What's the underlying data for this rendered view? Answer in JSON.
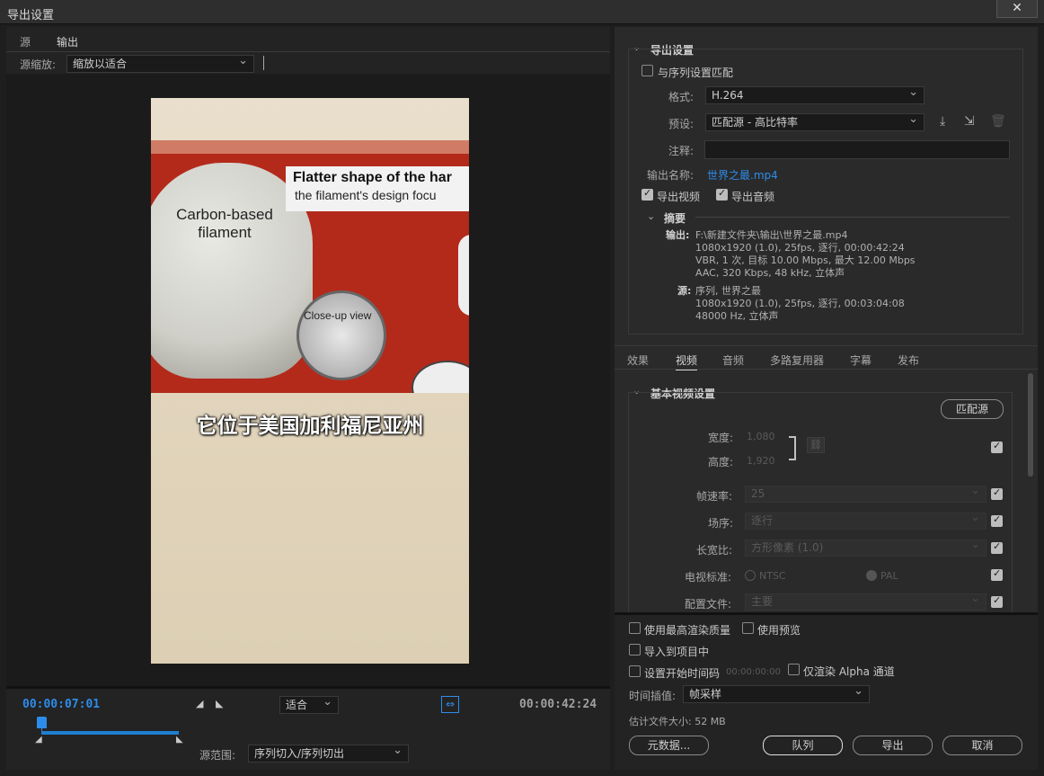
{
  "window": {
    "title": "导出设置",
    "close": "✕"
  },
  "left": {
    "tabs": [
      "源",
      "输出"
    ],
    "source_scaling_label": "源缩放:",
    "source_scaling_value": "缩放以适合",
    "preview": {
      "callout_line1": "Flatter shape of the har",
      "callout_line2": "the filament's design focu",
      "bulb_label": "Carbon-based filament",
      "closeup_label": "Close-up view",
      "subtitle": "它位于美国加利福尼亚州"
    },
    "timeline": {
      "current_time": "00:00:07:01",
      "end_time": "00:00:42:24",
      "fit_value": "适合",
      "source_range_label": "源范围:",
      "source_range_value": "序列切入/序列切出"
    }
  },
  "export": {
    "section_title": "导出设置",
    "match_sequence_label": "与序列设置匹配",
    "format_label": "格式:",
    "format_value": "H.264",
    "preset_label": "预设:",
    "preset_value": "匹配源 - 高比特率",
    "comment_label": "注释:",
    "comment_value": "",
    "output_name_label": "输出名称:",
    "output_name_value": "世界之最.mp4",
    "export_video_label": "导出视频",
    "export_audio_label": "导出音频",
    "summary_title": "摘要",
    "summary_output_label": "输出:",
    "summary_output_lines": [
      "F:\\新建文件夹\\输出\\世界之最.mp4",
      "1080x1920 (1.0), 25fps, 逐行, 00:00:42:24",
      "VBR, 1 次, 目标 10.00 Mbps, 最大 12.00 Mbps",
      "AAC, 320 Kbps, 48 kHz, 立体声"
    ],
    "summary_source_label": "源:",
    "summary_source_lines": [
      "序列, 世界之最",
      "1080x1920 (1.0), 25fps, 逐行, 00:03:04:08",
      "48000 Hz, 立体声"
    ]
  },
  "settings_tabs": [
    "效果",
    "视频",
    "音频",
    "多路复用器",
    "字幕",
    "发布"
  ],
  "video": {
    "section_title": "基本视频设置",
    "match_source_button": "匹配源",
    "width_label": "宽度:",
    "width_value": "1,080",
    "height_label": "高度:",
    "height_value": "1,920",
    "framerate_label": "帧速率:",
    "framerate_value": "25",
    "field_order_label": "场序:",
    "field_order_value": "逐行",
    "aspect_label": "长宽比:",
    "aspect_value": "方形像素 (1.0)",
    "tv_standard_label": "电视标准:",
    "ntsc": "NTSC",
    "pal": "PAL",
    "profile_label": "配置文件:",
    "profile_value": "主要"
  },
  "bottom": {
    "max_render_quality": "使用最高渲染质量",
    "use_previews": "使用预览",
    "import_into_project": "导入到项目中",
    "set_start_timecode": "设置开始时间码",
    "start_timecode_value": "00:00:00:00",
    "render_alpha_only": "仅渲染 Alpha 通道",
    "time_interpolation_label": "时间插值:",
    "time_interpolation_value": "帧采样",
    "estimated_size": "估计文件大小: 52 MB",
    "metadata_button": "元数据...",
    "queue_button": "队列",
    "export_button": "导出",
    "cancel_button": "取消"
  },
  "colors": {
    "accent": "#2d8ceb",
    "timeline_bar": "#1f7fd1"
  }
}
